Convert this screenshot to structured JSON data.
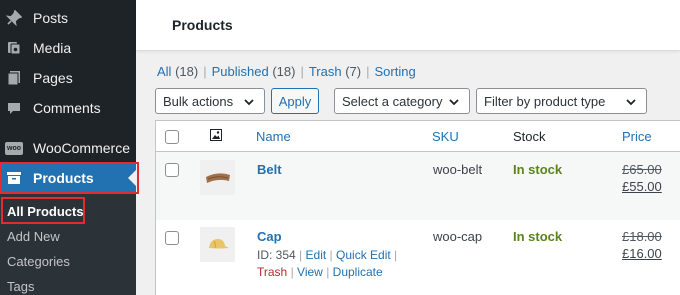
{
  "sidebar": {
    "items": [
      {
        "label": "Posts",
        "icon": "pin-icon"
      },
      {
        "label": "Media",
        "icon": "media-icon"
      },
      {
        "label": "Pages",
        "icon": "pages-icon"
      },
      {
        "label": "Comments",
        "icon": "comment-icon"
      },
      {
        "label": "WooCommerce",
        "icon": "woo-icon",
        "icon_text": "woo"
      },
      {
        "label": "Products",
        "icon": "archive-icon"
      }
    ],
    "submenu": [
      "All Products",
      "Add New",
      "Categories",
      "Tags"
    ]
  },
  "header": {
    "title": "Products"
  },
  "filters": {
    "all_label": "All",
    "all_count": "(18)",
    "published_label": "Published",
    "published_count": "(18)",
    "trash_label": "Trash",
    "trash_count": "(7)",
    "sorting_label": "Sorting",
    "bulk_actions": "Bulk actions",
    "apply": "Apply",
    "category": "Select a category",
    "product_type": "Filter by product type"
  },
  "table": {
    "columns": {
      "name": "Name",
      "sku": "SKU",
      "stock": "Stock",
      "price": "Price"
    },
    "rows": [
      {
        "name": "Belt",
        "sku": "woo-belt",
        "stock": "In stock",
        "old_price": "£65.00",
        "new_price": "£55.00"
      },
      {
        "name": "Cap",
        "sku": "woo-cap",
        "stock": "In stock",
        "old_price": "£18.00",
        "new_price": "£16.00",
        "actions": {
          "id": "ID: 354",
          "edit": "Edit",
          "quick_edit": "Quick Edit",
          "trash": "Trash",
          "view": "View",
          "duplicate": "Duplicate"
        }
      }
    ]
  },
  "colors": {
    "sidebar_bg": "#1d2327",
    "accent": "#2271b1",
    "highlight": "#e32d2d",
    "in_stock": "#5b841b"
  }
}
